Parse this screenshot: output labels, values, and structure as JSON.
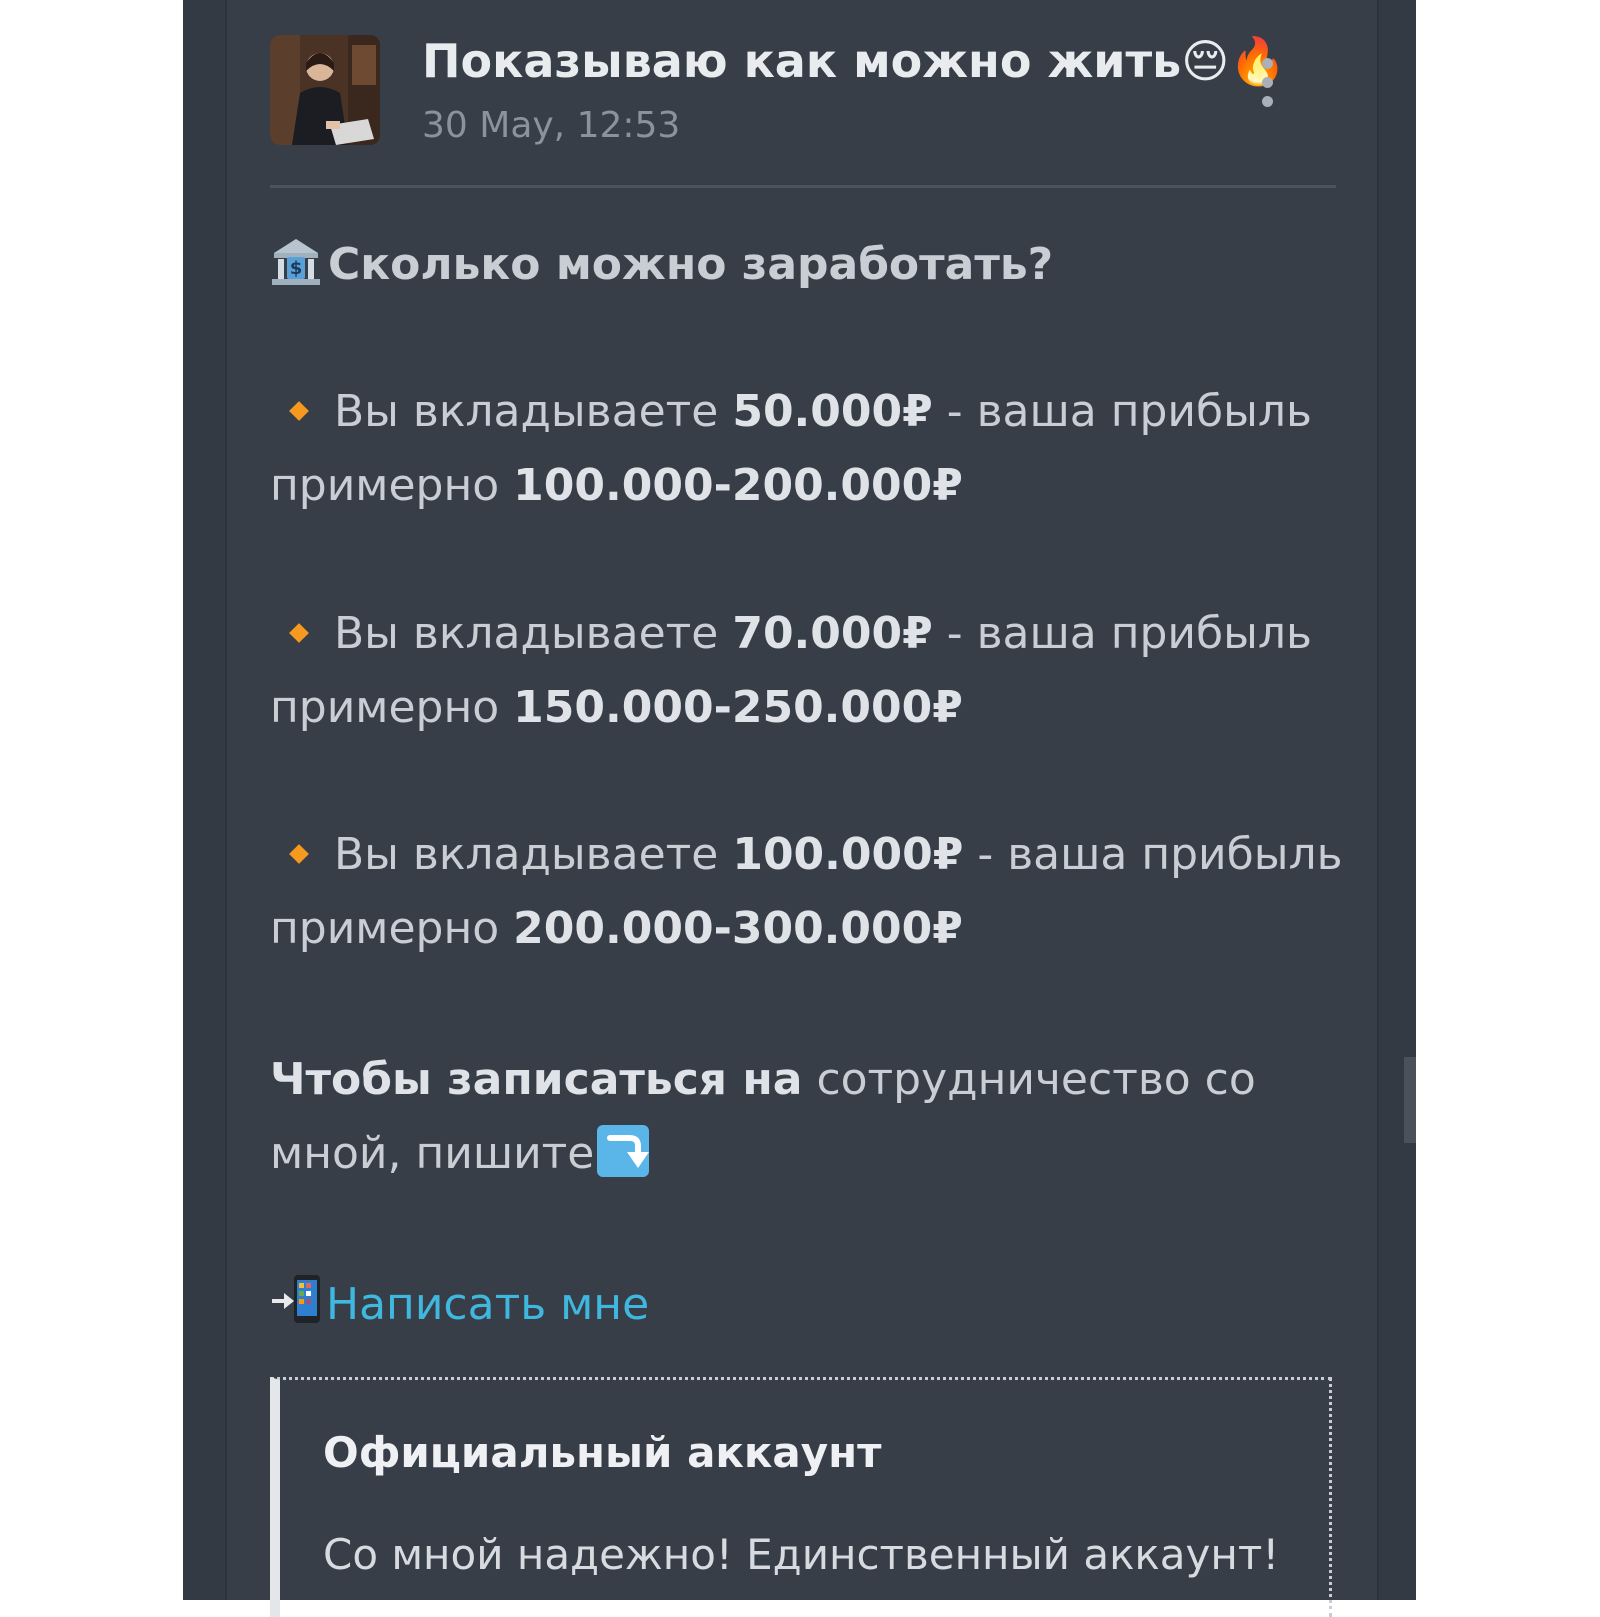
{
  "post": {
    "channel_name": "Показываю как можно жить",
    "channel_emojis": "😔🔥",
    "date": "30 May, 12:53",
    "heading": "Сколько можно заработать?",
    "offers": [
      {
        "prefix": "Вы вкладываете ",
        "amount": "50.000₽",
        "middle": " - ваша прибыль",
        "line2_prefix": "примерно ",
        "profit": "100.000-200.000₽"
      },
      {
        "prefix": "Вы вкладываете ",
        "amount": "70.000₽",
        "middle": " - ваша прибыль",
        "line2_prefix": "примерно ",
        "profit": "150.000-250.000₽"
      },
      {
        "prefix": "Вы вкладываете ",
        "amount": "100.000₽",
        "middle": " - ваша прибыль",
        "line2_prefix": "примерно ",
        "profit": "200.000-300.000₽"
      }
    ],
    "cta_bold": "Чтобы записаться на",
    "cta_rest": " сотрудничество со",
    "cta_line2": "мной, пишите",
    "contact_link": "Написать мне",
    "quote": {
      "title": "Официальный аккаунт",
      "text": "Со мной надежно! Единственный аккаунт!"
    }
  },
  "icons": {
    "avatar": "channel-avatar-photo",
    "menu": "more-vertical-icon",
    "heading_icon": "bank-icon",
    "bullet": "orange-diamond-icon",
    "cta_icon": "arrow-return-icon",
    "contact_icon": "phone-arrow-icon"
  },
  "colors": {
    "background": "#373e48",
    "link": "#3fb7de",
    "bullet": "#f59a1f",
    "text": "#c9ced4"
  }
}
